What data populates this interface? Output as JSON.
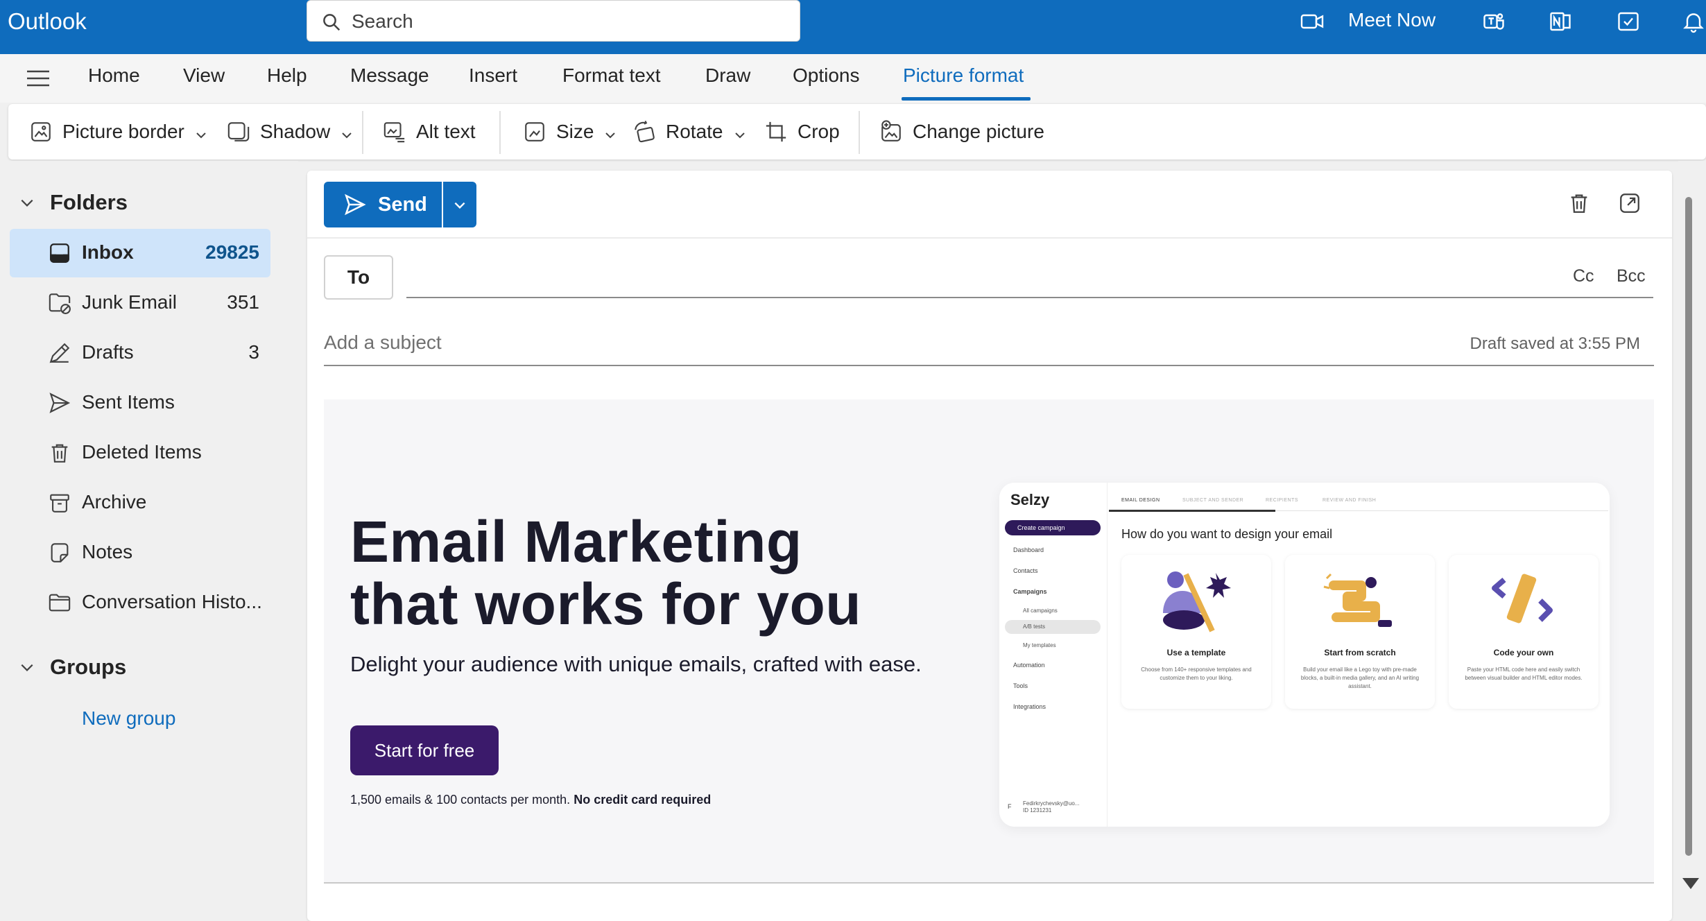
{
  "app": {
    "title": "Outlook"
  },
  "search": {
    "placeholder": "Search"
  },
  "topbar": {
    "meet_now": "Meet Now"
  },
  "ribbon_tabs": [
    "Home",
    "View",
    "Help",
    "Message",
    "Insert",
    "Format text",
    "Draw",
    "Options",
    "Picture format"
  ],
  "ribbon_active_tab": "Picture format",
  "toolbar": {
    "picture_border": "Picture border",
    "shadow": "Shadow",
    "alt_text": "Alt text",
    "size": "Size",
    "rotate": "Rotate",
    "crop": "Crop",
    "change_picture": "Change picture"
  },
  "sidebar": {
    "folders_heading": "Folders",
    "folders": [
      {
        "label": "Inbox",
        "count": "29825",
        "icon": "inbox-icon",
        "selected": true
      },
      {
        "label": "Junk Email",
        "count": "351",
        "icon": "junk-icon"
      },
      {
        "label": "Drafts",
        "count": "3",
        "icon": "drafts-icon"
      },
      {
        "label": "Sent Items",
        "count": "",
        "icon": "sent-icon"
      },
      {
        "label": "Deleted Items",
        "count": "",
        "icon": "trash-icon"
      },
      {
        "label": "Archive",
        "count": "",
        "icon": "archive-icon"
      },
      {
        "label": "Notes",
        "count": "",
        "icon": "notes-icon"
      },
      {
        "label": "Conversation Histo...",
        "count": "",
        "icon": "folder-icon"
      }
    ],
    "groups_heading": "Groups",
    "new_group": "New group"
  },
  "compose": {
    "send": "Send",
    "to": "To",
    "cc": "Cc",
    "bcc": "Bcc",
    "subject_placeholder": "Add a subject",
    "draft_status": "Draft saved at 3:55 PM"
  },
  "email_body": {
    "headline_1": "Email Marketing",
    "headline_2": "that works for you",
    "subline": "Delight your audience with unique emails, crafted with ease.",
    "cta": "Start for free",
    "fineprint": "1,500 emails & 100 contacts per month.",
    "fineprint_bold": "No credit card required",
    "mockup": {
      "logo": "Selzy",
      "create_campaign": "Create campaign",
      "nav": [
        "Dashboard",
        "Contacts",
        "Campaigns",
        "Automation",
        "Tools",
        "Integrations"
      ],
      "subnav": [
        "All campaigns",
        "A/B tests",
        "My templates"
      ],
      "user": "Fedirkrychevsky@uo...",
      "user_id": "ID 1231231",
      "user_initial": "F",
      "steps": [
        "EMAIL DESIGN",
        "SUBJECT AND SENDER",
        "RECIPIENTS",
        "REVIEW AND FINISH"
      ],
      "question": "How do you want to design your email",
      "cards": [
        {
          "title": "Use a template",
          "desc": "Choose from 140+ responsive templates and customize them to your liking."
        },
        {
          "title": "Start from scratch",
          "desc": "Build your email like a Lego toy with pre-made blocks, a built-in media gallery, and an AI writing assistant."
        },
        {
          "title": "Code your own",
          "desc": "Paste your HTML code here and easily switch between visual builder and HTML editor modes."
        }
      ]
    }
  },
  "colors": {
    "brand": "#0f6cbd",
    "selected_bg": "#cfe4fa",
    "cta": "#3b1a6b"
  }
}
